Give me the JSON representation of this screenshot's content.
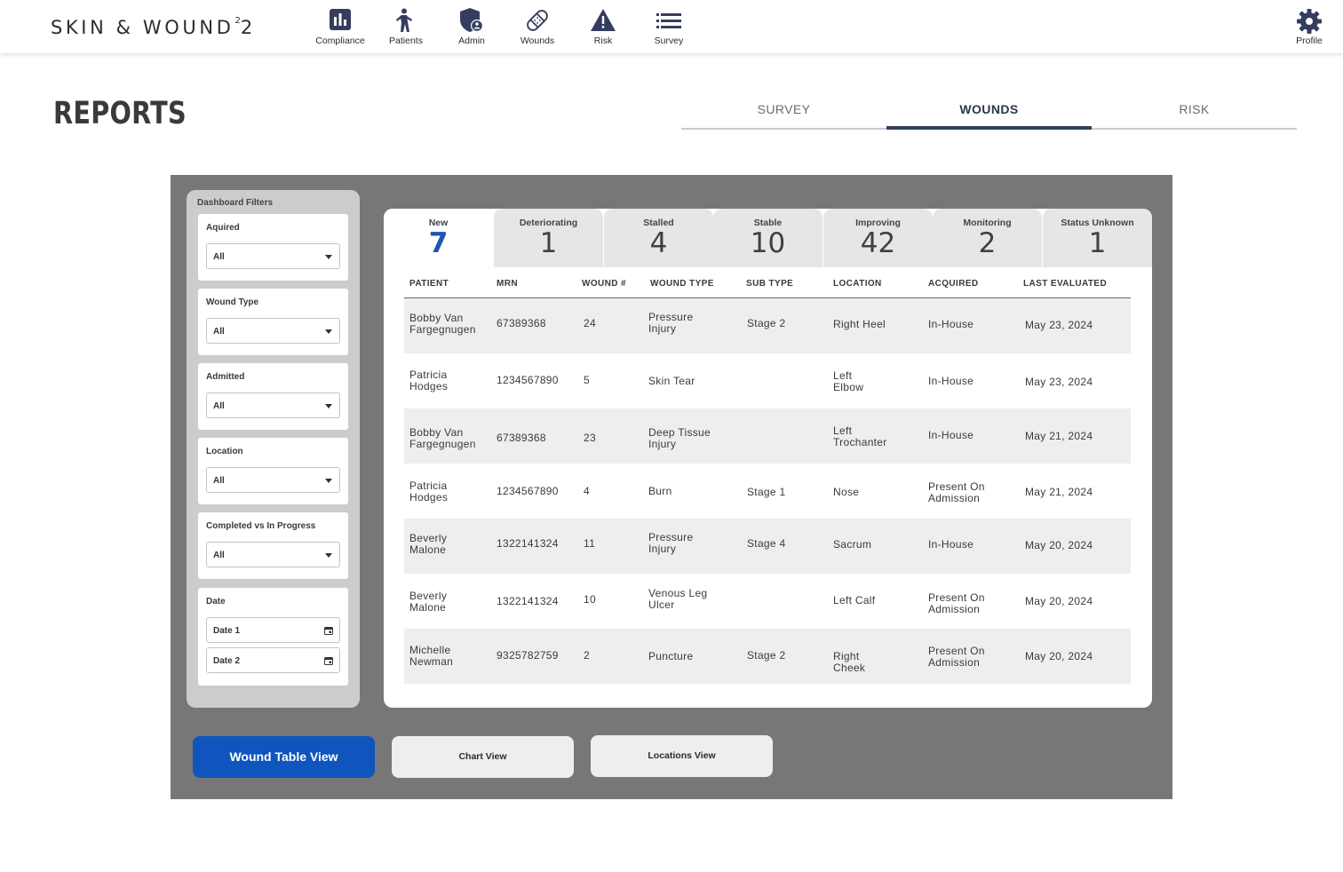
{
  "brand": {
    "name": "SKIN & WOUND",
    "superscript": "2",
    "suffix": "2"
  },
  "nav": [
    {
      "label": "Compliance",
      "icon": "chart-icon"
    },
    {
      "label": "Patients",
      "icon": "person-icon"
    },
    {
      "label": "Admin",
      "icon": "admin-shield-icon"
    },
    {
      "label": "Wounds",
      "icon": "bandage-icon"
    },
    {
      "label": "Risk",
      "icon": "warning-icon"
    },
    {
      "label": "Survey",
      "icon": "list-icon"
    }
  ],
  "profile": {
    "label": "Profile",
    "icon": "gear-icon"
  },
  "page": {
    "title": "REPORTS"
  },
  "tabs": [
    {
      "label": "SURVEY",
      "active": false
    },
    {
      "label": "WOUNDS",
      "active": true
    },
    {
      "label": "RISK",
      "active": false
    }
  ],
  "filters": {
    "title": "Dashboard Filters",
    "items": [
      {
        "label": "Aquired",
        "value": "All"
      },
      {
        "label": "Wound Type",
        "value": "All"
      },
      {
        "label": "Admitted",
        "value": "All"
      },
      {
        "label": "Location",
        "value": "All"
      },
      {
        "label": "Completed vs In Progress",
        "value": "All"
      }
    ],
    "date": {
      "label": "Date",
      "date1": "Date 1",
      "date2": "Date 2"
    }
  },
  "status_tabs": [
    {
      "label": "New",
      "count": "7",
      "active": true
    },
    {
      "label": "Deteriorating",
      "count": "1",
      "active": false
    },
    {
      "label": "Stalled",
      "count": "4",
      "active": false
    },
    {
      "label": "Stable",
      "count": "10",
      "active": false
    },
    {
      "label": "Improving",
      "count": "42",
      "active": false
    },
    {
      "label": "Monitoring",
      "count": "2",
      "active": false
    },
    {
      "label": "Status Unknown",
      "count": "1",
      "active": false
    }
  ],
  "table": {
    "columns": [
      "PATIENT",
      "MRN",
      "WOUND #",
      "WOUND TYPE",
      "SUB TYPE",
      "LOCATION",
      "ACQUIRED",
      "LAST EVALUATED"
    ],
    "rows": [
      {
        "patient": "Bobby Van\nFargegnugen",
        "mrn": "67389368",
        "wound_no": "24",
        "wound_type": "Pressure\nInjury",
        "sub_type": "Stage 2",
        "location": "Right Heel",
        "acquired": "In-House",
        "last_evaluated": "May 23, 2024"
      },
      {
        "patient": "Patricia\nHodges",
        "mrn": "1234567890",
        "wound_no": "5",
        "wound_type": "Skin Tear",
        "sub_type": "",
        "location": "Left\nElbow",
        "acquired": "In-House",
        "last_evaluated": "May 23, 2024"
      },
      {
        "patient": "Bobby Van\nFargegnugen",
        "mrn": "67389368",
        "wound_no": "23",
        "wound_type": "Deep Tissue\nInjury",
        "sub_type": "",
        "location": "Left\nTrochanter",
        "acquired": "In-House",
        "last_evaluated": "May 21, 2024"
      },
      {
        "patient": "Patricia\nHodges",
        "mrn": "1234567890",
        "wound_no": "4",
        "wound_type": "Burn",
        "sub_type": "Stage 1",
        "location": "Nose",
        "acquired": "Present On\nAdmission",
        "last_evaluated": "May 21, 2024"
      },
      {
        "patient": "Beverly\nMalone",
        "mrn": "1322141324",
        "wound_no": "11",
        "wound_type": "Pressure\nInjury",
        "sub_type": "Stage 4",
        "location": "Sacrum",
        "acquired": "In-House",
        "last_evaluated": "May 20, 2024"
      },
      {
        "patient": "Beverly\nMalone",
        "mrn": "1322141324",
        "wound_no": "10",
        "wound_type": "Venous Leg\nUlcer",
        "sub_type": "",
        "location": "Left Calf",
        "acquired": "Present On\nAdmission",
        "last_evaluated": "May 20, 2024"
      },
      {
        "patient": "Michelle\nNewman",
        "mrn": "9325782759",
        "wound_no": "2",
        "wound_type": "Puncture",
        "sub_type": "Stage 2",
        "location": "Right\nCheek",
        "acquired": "Present On\nAdmission",
        "last_evaluated": "May 20, 2024"
      }
    ]
  },
  "views": [
    {
      "label": "Wound Table View",
      "active": true
    },
    {
      "label": "Chart View",
      "active": false
    },
    {
      "label": "Locations View",
      "active": false
    }
  ],
  "colors": {
    "nav_icon": "#343d5e",
    "accent_blue": "#0f55bd",
    "count_blue": "#1b56b4",
    "frame_gray": "#777777"
  }
}
